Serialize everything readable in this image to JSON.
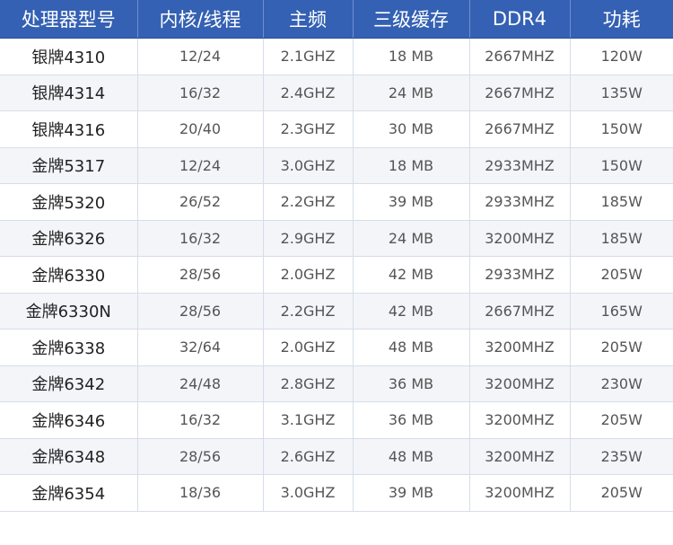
{
  "table": {
    "headers": [
      "处理器型号",
      "内核/线程",
      "主频",
      "三级缓存",
      "DDR4",
      "功耗"
    ],
    "rows": [
      [
        "银牌4310",
        "12/24",
        "2.1GHZ",
        "18 MB",
        "2667MHZ",
        "120W"
      ],
      [
        "银牌4314",
        "16/32",
        "2.4GHZ",
        "24 MB",
        "2667MHZ",
        "135W"
      ],
      [
        "银牌4316",
        "20/40",
        "2.3GHZ",
        "30 MB",
        "2667MHZ",
        "150W"
      ],
      [
        "金牌5317",
        "12/24",
        "3.0GHZ",
        "18 MB",
        "2933MHZ",
        "150W"
      ],
      [
        "金牌5320",
        "26/52",
        "2.2GHZ",
        "39 MB",
        "2933MHZ",
        "185W"
      ],
      [
        "金牌6326",
        "16/32",
        "2.9GHZ",
        "24 MB",
        "3200MHZ",
        "185W"
      ],
      [
        "金牌6330",
        "28/56",
        "2.0GHZ",
        "42 MB",
        "2933MHZ",
        "205W"
      ],
      [
        "金牌6330N",
        "28/56",
        "2.2GHZ",
        "42 MB",
        "2667MHZ",
        "165W"
      ],
      [
        "金牌6338",
        "32/64",
        "2.0GHZ",
        "48 MB",
        "3200MHZ",
        "205W"
      ],
      [
        "金牌6342",
        "24/48",
        "2.8GHZ",
        "36 MB",
        "3200MHZ",
        "230W"
      ],
      [
        "金牌6346",
        "16/32",
        "3.1GHZ",
        "36 MB",
        "3200MHZ",
        "205W"
      ],
      [
        "金牌6348",
        "28/56",
        "2.6GHZ",
        "48 MB",
        "3200MHZ",
        "235W"
      ],
      [
        "金牌6354",
        "18/36",
        "3.0GHZ",
        "39 MB",
        "3200MHZ",
        "205W"
      ]
    ]
  },
  "colors": {
    "header_bg": "#3461b3",
    "header_text": "#ffffff",
    "row_alt_bg": "#f3f5f9",
    "grid_line": "#d6dde8"
  }
}
